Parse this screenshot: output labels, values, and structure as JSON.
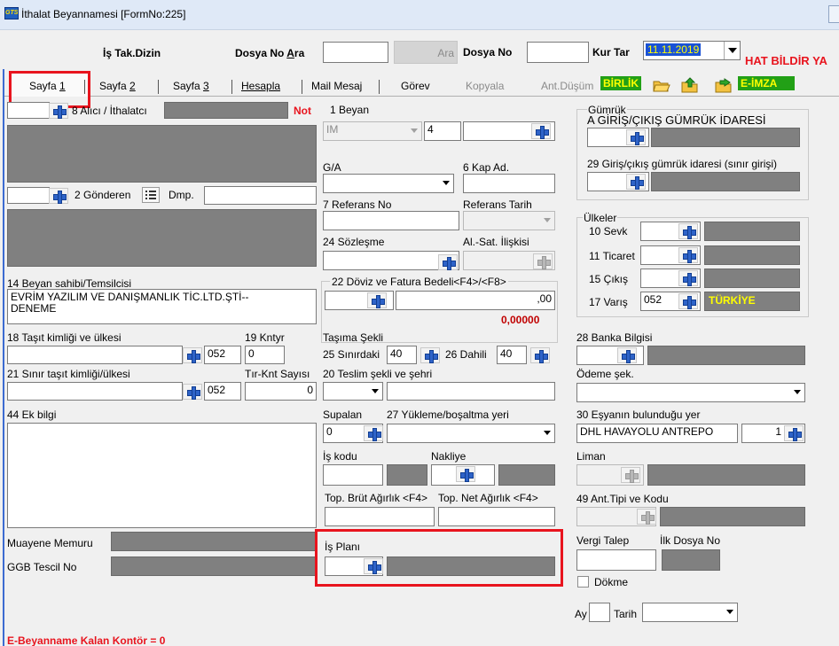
{
  "window": {
    "title": "İthalat Beyannamesi [FormNo:225]"
  },
  "toolbar": {
    "is_tak_dizin": "İş Tak.Dizin",
    "dosya_no_ara_label": "Dosya No Ara",
    "dosya_no_ara_value": "",
    "ara_button": "Ara",
    "dosya_no_label": "Dosya No",
    "dosya_no_value": "",
    "kur_tar_label": "Kur Tar",
    "kur_tar_value": "11.11.2019",
    "hat_bildir": "HAT BİLDİR YA"
  },
  "tabs": {
    "sayfa1": "Sayfa 1",
    "sayfa2": "Sayfa 2",
    "sayfa3": "Sayfa 3",
    "hesapla": "Hesapla",
    "mail_mesaj": "Mail Mesaj",
    "gorev": "Görev",
    "kopyala": "Kopyala",
    "ant_dusum": "Ant.Düşüm",
    "birlik": "BİRLİK",
    "e_imza": "E-İMZA"
  },
  "left": {
    "alici_label": "8 Alıcı / İthalatcı",
    "not_badge": "Not",
    "gonderen_label": "2 Gönderen",
    "dmp_label": "Dmp.",
    "beyan_sahibi_label": "14 Beyan sahibi/Temsilcisi",
    "beyan_sahibi_line1": "EVRİM YAZILIM VE DANIŞMANLIK TİC.LTD.ŞTİ--",
    "beyan_sahibi_line2": "DENEME",
    "tasit_label": "18 Taşıt kimliği ve ülkesi",
    "tasit_code": "052",
    "kntyr_label": "19 Kntyr",
    "kntyr_value": "0",
    "sinir_tasit_label": "21 Sınır taşıt kimliği/ülkesi",
    "sinir_tasit_code": "052",
    "tir_knt_label": "Tır-Knt Sayısı",
    "tir_knt_value": "0",
    "ek_bilgi_label": "44 Ek bilgi",
    "muayene_label": "Muayene Memuru",
    "ggb_label": "GGB Tescil No",
    "footer": "E-Beyanname Kalan Kontör = 0"
  },
  "middle": {
    "beyan_label": "1 Beyan",
    "beyan_type": "IM",
    "beyan_no": "4",
    "ga_label": "G/A",
    "kap_label": "6 Kap Ad.",
    "referans_no_label": "7 Referans No",
    "referans_tarih_label": "Referans Tarih",
    "sozlesme_label": "24 Sözleşme",
    "al_sat_label": "Al.-Sat. İlişkisi",
    "doviz_label": "22 Döviz ve Fatura Bedeli<F4>/<F8>",
    "doviz_value": ",00",
    "doviz_total": "0,00000",
    "tasima_label": "Taşıma Şekli",
    "sinirdaki_label": "25 Sınırdaki",
    "sinirdaki_value": "40",
    "dahili_label": "26 Dahili",
    "dahili_value": "40",
    "teslim_label": "20 Teslim şekli ve şehri",
    "supalan_label": "Supalan",
    "supalan_value": "0",
    "yukleme_label": "27 Yükleme/boşaltma yeri",
    "is_kodu_label": "İş kodu",
    "nakliye_label": "Nakliye",
    "brut_label": "Top. Brüt Ağırlık <F4>",
    "net_label": "Top. Net Ağırlık <F4>",
    "is_plani_label": "İş Planı"
  },
  "right": {
    "gumruk_label": "Gümrük",
    "giris_cikis_label": "A GİRİŞ/ÇIKIŞ GÜMRÜK İDARESİ",
    "sinir_girisi_label": "29 Giriş/çıkış gümrük idaresi (sınır girişi)",
    "ulkeler_label": "Ülkeler",
    "sevk_label": "10 Sevk",
    "ticaret_label": "11 Ticaret",
    "cikis_label": "15 Çıkış",
    "varis_label": "17 Varış",
    "varis_code": "052",
    "varis_country": "TÜRKİYE",
    "banka_label": "28 Banka Bilgisi",
    "odeme_label": "Ödeme şek.",
    "esya_label": "30 Eşyanın bulunduğu yer",
    "esya_value": "DHL HAVAYOLU ANTREPO",
    "esya_no": "1",
    "liman_label": "Liman",
    "ant_tipi_label": "49 Ant.Tipi ve Kodu",
    "vergi_talep_label": "Vergi Talep",
    "ilk_dosya_label": "İlk Dosya No",
    "dokme_label": "Dökme",
    "ay_label": "Ay",
    "tarih_label": "Tarih"
  },
  "colors": {
    "accent_red": "#e8141e",
    "badge_green": "#22a016",
    "badge_yellow": "#ffff00",
    "field_gray": "#808080",
    "date_blue": "#1a52d6",
    "navy": "#0c2f9a"
  }
}
